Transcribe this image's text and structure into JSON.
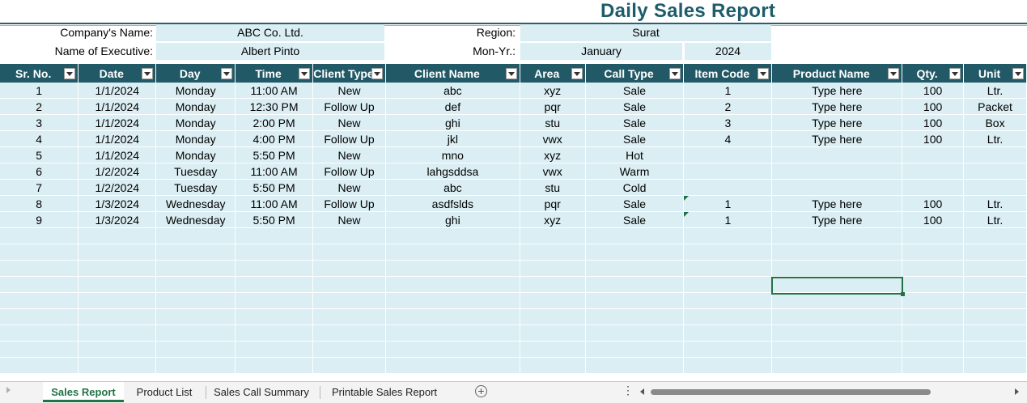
{
  "report": {
    "title": "Daily Sales Report",
    "company_label": "Company's Name:",
    "company_value": "ABC Co. Ltd.",
    "executive_label": "Name of Executive:",
    "executive_value": "Albert Pinto",
    "region_label": "Region:",
    "region_value": "Surat",
    "monyr_label": "Mon-Yr.:",
    "month_value": "January",
    "year_value": "2024"
  },
  "table": {
    "columns": [
      "Sr. No.",
      "Date",
      "Day",
      "Time",
      "Client Type",
      "Client Name",
      "Area",
      "Call Type",
      "Item Code",
      "Product Name",
      "Qty.",
      "Unit"
    ],
    "rows": [
      [
        "1",
        "1/1/2024",
        "Monday",
        "11:00 AM",
        "New",
        "abc",
        "xyz",
        "Sale",
        "1",
        "Type here",
        "100",
        "Ltr."
      ],
      [
        "2",
        "1/1/2024",
        "Monday",
        "12:30 PM",
        "Follow Up",
        "def",
        "pqr",
        "Sale",
        "2",
        "Type here",
        "100",
        "Packet"
      ],
      [
        "3",
        "1/1/2024",
        "Monday",
        "2:00 PM",
        "New",
        "ghi",
        "stu",
        "Sale",
        "3",
        "Type here",
        "100",
        "Box"
      ],
      [
        "4",
        "1/1/2024",
        "Monday",
        "4:00 PM",
        "Follow Up",
        "jkl",
        "vwx",
        "Sale",
        "4",
        "Type here",
        "100",
        "Ltr."
      ],
      [
        "5",
        "1/1/2024",
        "Monday",
        "5:50 PM",
        "New",
        "mno",
        "xyz",
        "Hot",
        "",
        "",
        "",
        ""
      ],
      [
        "6",
        "1/2/2024",
        "Tuesday",
        "11:00 AM",
        "Follow Up",
        "lahgsddsa",
        "vwx",
        "Warm",
        "",
        "",
        "",
        ""
      ],
      [
        "7",
        "1/2/2024",
        "Tuesday",
        "5:50 PM",
        "New",
        "abc",
        "stu",
        "Cold",
        "",
        "",
        "",
        ""
      ],
      [
        "8",
        "1/3/2024",
        "Wednesday",
        "11:00 AM",
        "Follow Up",
        "asdfslds",
        "pqr",
        "Sale",
        "1",
        "Type here",
        "100",
        "Ltr."
      ],
      [
        "9",
        "1/3/2024",
        "Wednesday",
        "5:50 PM",
        "New",
        "ghi",
        "xyz",
        "Sale",
        "1",
        "Type here",
        "100",
        "Ltr."
      ]
    ],
    "error_flag_rows": [
      7,
      8
    ],
    "empty_row_count": 9
  },
  "sheets": {
    "tabs": [
      "Sales Report",
      "Product List",
      "Sales Call Summary",
      "Printable Sales Report"
    ],
    "active": "Sales Report"
  },
  "colors": {
    "header_bg": "#215967",
    "cell_bg": "#daeef3",
    "title_color": "#1e5c6b",
    "selection": "#217346"
  }
}
